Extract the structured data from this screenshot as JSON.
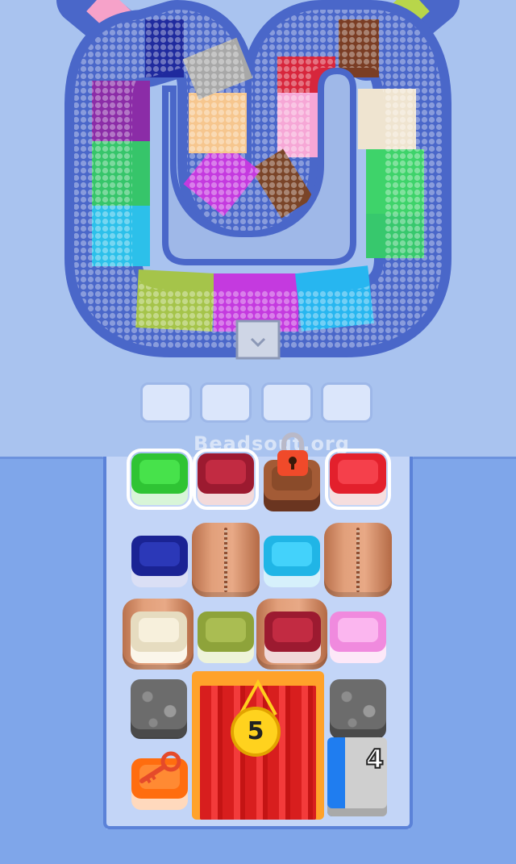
{
  "watermark": "Beadsout.org",
  "holding_slots": {
    "count": 4,
    "filled": 0
  },
  "curtain_counter": "5",
  "gray_block_counter": "4",
  "colors": {
    "background": "#a9c3ef",
    "track_border": "#4a67c9",
    "green": "#37d13b",
    "dark_red": "#b0213a",
    "brown": "#8a4b2a",
    "red": "#ee2a36",
    "navy": "#1f2a9e",
    "cyan": "#2ec4f2",
    "cream": "#efe4c8",
    "olive": "#9fb343",
    "pink": "#f7a9e6",
    "orange": "#ff7a1a"
  },
  "track_segments": [
    "pink",
    "navy",
    "purple",
    "green",
    "cyan",
    "olive",
    "magenta",
    "sky-blue",
    "green",
    "white",
    "brown",
    "pink",
    "red",
    "brown",
    "magenta",
    "peach",
    "gray"
  ],
  "grid": {
    "row1": [
      "green-tray",
      "dark-red-tray",
      "locked-brown-tray",
      "red-tray"
    ],
    "row2": [
      "navy-tray",
      "bag",
      "cyan-tray",
      "bag"
    ],
    "row3": [
      "cream-tray-in-bag",
      "olive-tray",
      "dark-red-tray-in-bag",
      "pink-tray"
    ],
    "row4": [
      "stone",
      "curtain-stage",
      "stone"
    ],
    "row5": [
      "key-tray",
      "curtain-stage",
      "gray-counter-block"
    ]
  }
}
